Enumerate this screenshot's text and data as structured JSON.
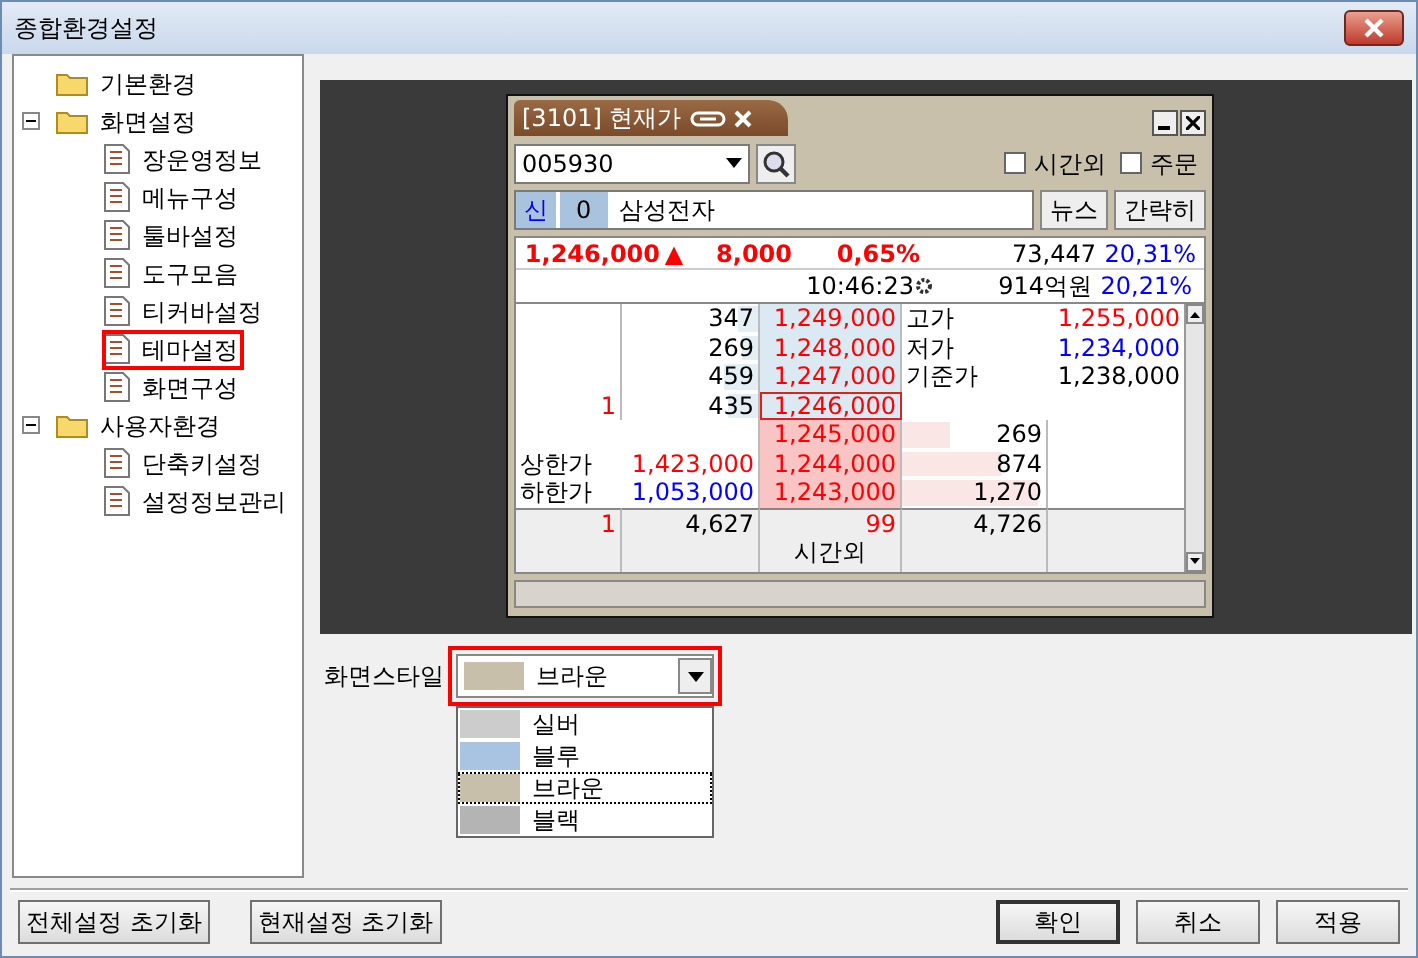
{
  "window": {
    "title": "종합환경설정"
  },
  "tree": [
    {
      "label": "기본환경",
      "kind": "folder",
      "selected": false
    },
    {
      "label": "화면설정",
      "kind": "folder",
      "expanded": true,
      "selected": false,
      "children": [
        {
          "label": "장운영정보",
          "kind": "page",
          "selected": false
        },
        {
          "label": "메뉴구성",
          "kind": "page",
          "selected": false
        },
        {
          "label": "툴바설정",
          "kind": "page",
          "selected": false
        },
        {
          "label": "도구모음",
          "kind": "page",
          "selected": false
        },
        {
          "label": "티커바설정",
          "kind": "page",
          "selected": false
        },
        {
          "label": "테마설정",
          "kind": "page",
          "selected": true
        },
        {
          "label": "화면구성",
          "kind": "page",
          "selected": false
        }
      ]
    },
    {
      "label": "사용자환경",
      "kind": "folder",
      "expanded": true,
      "selected": false,
      "children": [
        {
          "label": "단축키설정",
          "kind": "page",
          "selected": false
        },
        {
          "label": "설정정보관리",
          "kind": "page",
          "selected": false
        }
      ]
    }
  ],
  "preview": {
    "tab_title": "[3101] 현재가",
    "code": "005930",
    "checkboxes": [
      {
        "label": "시간외",
        "checked": false
      },
      {
        "label": "주문",
        "checked": false
      }
    ],
    "market_badge": "신",
    "count_badge": "0",
    "stock_name": "삼성전자",
    "buttons": [
      "뉴스",
      "간략히"
    ],
    "price": {
      "value": "1,246,000",
      "arrow": "▲",
      "change": "8,000",
      "rate": "0,65%",
      "volume": "73,447",
      "volume_rate": "20,31%"
    },
    "time": "10:46:23",
    "amount": "914억원",
    "amount_rate": "20,21%",
    "asks": [
      {
        "qty": "347",
        "level": 0.14,
        "price": "1,249,000",
        "current": false,
        "info": {
          "label": "고가",
          "value": "1,255,000",
          "color": "#ff0000"
        }
      },
      {
        "qty": "269",
        "level": 0.12,
        "price": "1,248,000",
        "current": false,
        "info": {
          "label": "저가",
          "value": "1,234,000",
          "color": "#0000ff"
        }
      },
      {
        "qty": "459",
        "level": 0.25,
        "price": "1,247,000",
        "current": false,
        "info": {
          "label": "기준가",
          "value": "1,238,000",
          "color": "#000000"
        }
      },
      {
        "count": "1",
        "qty": "435",
        "level": 0.22,
        "price": "1,246,000",
        "current": true
      }
    ],
    "bids": [
      {
        "price": "1,245,000",
        "qty": "269",
        "level": 0.33
      },
      {
        "limit": {
          "label": "상한가",
          "value": "1,423,000",
          "color": "#ff0000"
        },
        "price": "1,244,000",
        "qty": "874",
        "level": 0.7
      },
      {
        "limit": {
          "label": "하한가",
          "value": "1,053,000",
          "color": "#0000ff"
        },
        "price": "1,243,000",
        "qty": "1,270",
        "level": 0.95
      }
    ],
    "totals": {
      "ask_count": "1",
      "ask_qty": "4,627",
      "after_hours_qty": "99",
      "after_hours_label": "시간외",
      "bid_qty": "4,726"
    }
  },
  "style": {
    "label": "화면스타일",
    "value": "브라운",
    "color": "#c8bfaa",
    "options": [
      {
        "label": "실버",
        "color": "#cccccc",
        "selected": false
      },
      {
        "label": "블루",
        "color": "#a8c4e2",
        "selected": false
      },
      {
        "label": "브라운",
        "color": "#c8bfaa",
        "selected": true
      },
      {
        "label": "블랙",
        "color": "#b4b4b4",
        "selected": false
      }
    ]
  },
  "buttons": {
    "left": [
      "전체설정 초기화",
      "현재설정 초기화"
    ],
    "right": [
      {
        "label": "확인",
        "default": true
      },
      {
        "label": "취소",
        "default": false
      },
      {
        "label": "적용",
        "default": false
      }
    ]
  }
}
